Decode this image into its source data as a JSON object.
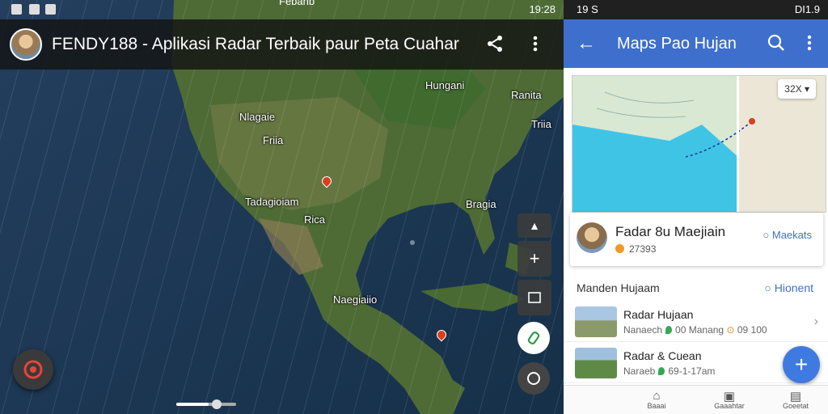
{
  "left": {
    "status_bar": {
      "top_text": "Febanb",
      "time": "19:28"
    },
    "title": "FENDY188 - Aplikasi Radar  Terbaik paur Peta Cuahar",
    "icons": {
      "share": "share-icon",
      "more": "more-vert-icon"
    },
    "places": [
      {
        "id": "hungani",
        "text": "Hungani"
      },
      {
        "id": "ranita",
        "text": "Ranita"
      },
      {
        "id": "nlagaie",
        "text": "Nlagaie"
      },
      {
        "id": "friia1",
        "text": "Friia"
      },
      {
        "id": "triia",
        "text": "Triia"
      },
      {
        "id": "tadagioiam",
        "text": "Tadagioiam"
      },
      {
        "id": "rica",
        "text": "Rica"
      },
      {
        "id": "bragia",
        "text": "Bragia"
      },
      {
        "id": "naegiaiio",
        "text": "Naegiaiio"
      }
    ],
    "controls": {
      "zoom_in": "+",
      "layers": "layers-icon"
    }
  },
  "right": {
    "status_bar": {
      "left": "19 S",
      "right": "DI1.9"
    },
    "appbar_title": "Maps Pao Hujan",
    "map_zoom": "32X",
    "card": {
      "name": "Fadar 8u Maejiain",
      "sub": "27393",
      "action": "Maekats"
    },
    "section": {
      "title": "Manden Hujaam",
      "action": "Hionent"
    },
    "list": [
      {
        "title": "Radar Hujaan",
        "sub_a": "Nanaech",
        "sub_b": "00 Manang",
        "sub_c": "09 100"
      },
      {
        "title": "Radar & Cuean",
        "sub_a": "Naraeb",
        "sub_b": "69-1-17am",
        "sub_c": ""
      },
      {
        "title": "",
        "sub_a": "",
        "sub_b": "",
        "sub_c": ""
      }
    ],
    "fab": "+",
    "bottom_nav": [
      {
        "label": "Baaai",
        "icon": "home-icon"
      },
      {
        "label": "Gaaahtar",
        "icon": "calendar-icon"
      },
      {
        "label": "Goeetat",
        "icon": "doc-icon"
      }
    ]
  },
  "colors": {
    "appbar": "#3f6fcc",
    "accent": "#3f7ae0",
    "marker": "#d7401e"
  }
}
